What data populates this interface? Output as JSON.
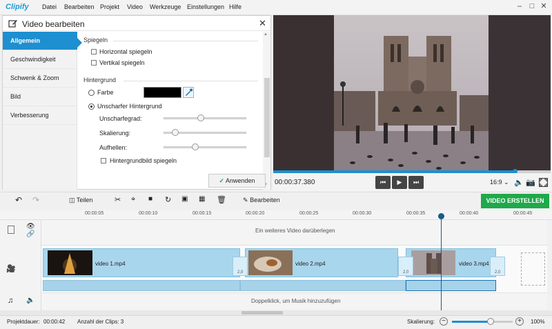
{
  "app": {
    "logo": "Clipify"
  },
  "menu": [
    "Datei",
    "Bearbeiten",
    "Projekt",
    "Video",
    "Werkzeuge",
    "Einstellungen",
    "Hilfe"
  ],
  "edit_panel": {
    "title": "Video bearbeiten",
    "nav": [
      "Allgemein",
      "Geschwindigkeit",
      "Schwenk & Zoom",
      "Bild",
      "Verbesserung"
    ],
    "mirror_section": "Spiegeln",
    "mirror_h": "Horizontal spiegeln",
    "mirror_v": "Vertikal spiegeln",
    "bg_section": "Hintergrund",
    "bg_color": "Farbe",
    "bg_blur": "Unscharfer Hintergrund",
    "blur_label": "Unscharfegrad:",
    "scale_label": "Skalierung:",
    "brighten_label": "Aufhellen:",
    "bg_mirror": "Hintergrundbild spiegeln",
    "apply": "Anwenden",
    "blur_level": 0.45,
    "scale_level": 0.14,
    "brighten_level": 0.38
  },
  "player": {
    "time": "00:00:37.380",
    "aspect": "16:9",
    "progress": 0.87
  },
  "toolbar": {
    "split": "Teilen",
    "edit": "Bearbeiten",
    "export": "VIDEO ERSTELLEN"
  },
  "timeline": {
    "ticks": [
      "00:00:05",
      "00:00:10",
      "00:00:15",
      "00:00:20",
      "00:00:25",
      "00:00:30",
      "00:00:35",
      "00:00:40",
      "00:00:45"
    ],
    "overlay_hint": "Ein weiteres Video darüberlegen",
    "music_hint": "Doppelklick, um Musik hinzuzufügen",
    "clips": [
      "video 1.mp4",
      "video 2.mp4",
      "video 3.mp4"
    ],
    "transition_label": "2,0"
  },
  "status": {
    "duration_label": "Projektdauer:",
    "duration": "00:00:42",
    "clips_label": "Anzahl der Clips: 3",
    "zoom_label": "Skalierung:",
    "zoom": "100%"
  },
  "colors": {
    "accent": "#1e8fd0",
    "export": "#1fa94a"
  }
}
